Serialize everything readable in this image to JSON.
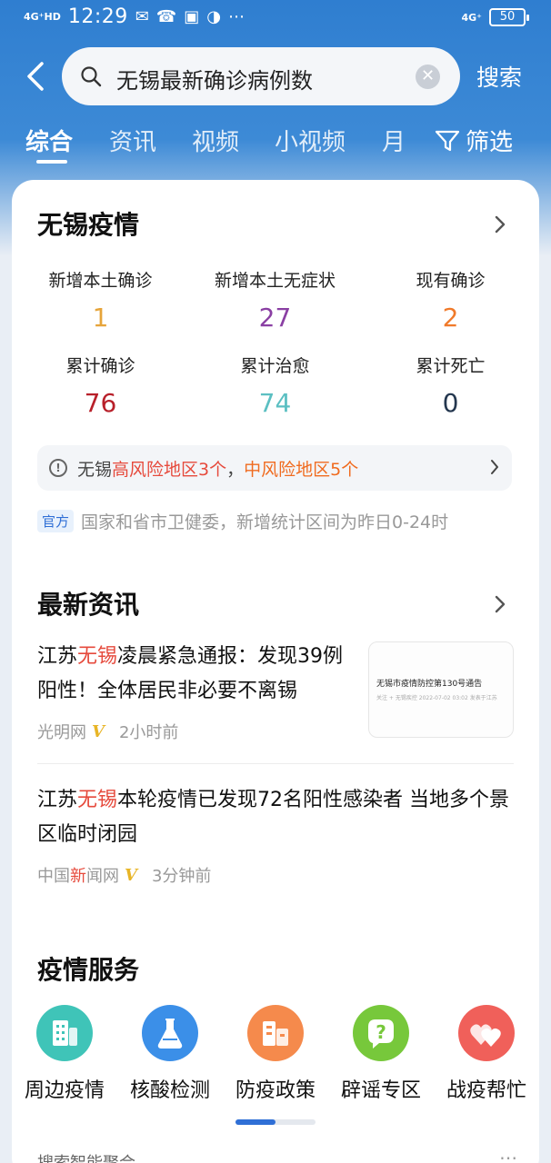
{
  "status_bar": {
    "network_left": "4G⁺HD",
    "time": "12:29",
    "icons": [
      "notification-icon",
      "phone-icon",
      "app-icon",
      "app-icon-2",
      "more-dots"
    ],
    "network_right": "4G⁺",
    "battery": "50"
  },
  "search": {
    "query": "无锡最新确诊病例数",
    "button_label": "搜索"
  },
  "tabs": {
    "items": [
      "综合",
      "资讯",
      "视频",
      "小视频",
      "月"
    ],
    "active": "综合",
    "filter_label": "筛选"
  },
  "epidemic": {
    "title": "无锡疫情",
    "stats": [
      {
        "label": "新增本土确诊",
        "value": "1",
        "color": "#e6a43a"
      },
      {
        "label": "新增本土无症状",
        "value": "27",
        "color": "#8a3fa3"
      },
      {
        "label": "现有确诊",
        "value": "2",
        "color": "#f07a2a"
      },
      {
        "label": "累计确诊",
        "value": "76",
        "color": "#b8202a"
      },
      {
        "label": "累计治愈",
        "value": "74",
        "color": "#5bbfc2"
      },
      {
        "label": "累计死亡",
        "value": "0",
        "color": "#24374f"
      }
    ],
    "risk": {
      "prefix": "无锡",
      "high": "高风险地区3个",
      "sep": "，",
      "mid": "中风险地区5个"
    },
    "source_badge": "官方",
    "source_text": "国家和省市卫健委，新增统计区间为昨日0-24时"
  },
  "news": {
    "title": "最新资讯",
    "items": [
      {
        "title_pre": "江苏",
        "title_hl": "无锡",
        "title_post": "凌晨紧急通报：发现39例阳性！全体居民非必要不离锡",
        "source": "光明网",
        "time": "2小时前",
        "thumb_title": "无锡市疫情防控第130号通告",
        "thumb_sub": "关注 + 无锡疾控  2022-07-02 03:02  发表于江苏"
      },
      {
        "title_pre": "江苏",
        "title_hl": "无锡",
        "title_post": "本轮疫情已发现72名阳性感染者 当地多个景区临时闭园",
        "source_pre": "中国",
        "source_hl": "新",
        "source_post": "闻网",
        "time": "3分钟前"
      }
    ]
  },
  "services": {
    "title": "疫情服务",
    "items": [
      {
        "label": "周边疫情",
        "icon": "building-icon",
        "color": "#3fc4b8"
      },
      {
        "label": "核酸检测",
        "icon": "flask-icon",
        "color": "#3b8fe8"
      },
      {
        "label": "防疫政策",
        "icon": "city-icon",
        "color": "#f58a4c"
      },
      {
        "label": "辟谣专区",
        "icon": "question-icon",
        "color": "#77c83b"
      },
      {
        "label": "战疫帮忙",
        "icon": "hearts-icon",
        "color": "#f0605a"
      }
    ]
  },
  "bottom_peek": "搜索智能聚合"
}
